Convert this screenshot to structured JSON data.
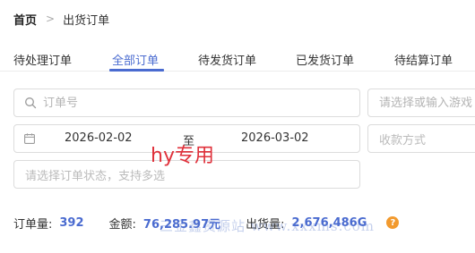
{
  "breadcrumb": {
    "home": "首页",
    "separator": ">",
    "current": "出货订单"
  },
  "tabs": [
    {
      "label": "待处理订单",
      "active": false
    },
    {
      "label": "全部订单",
      "active": true
    },
    {
      "label": "待发货订单",
      "active": false
    },
    {
      "label": "已发货订单",
      "active": false
    },
    {
      "label": "待结算订单",
      "active": false
    }
  ],
  "filters": {
    "order_no_placeholder": "订单号",
    "product_placeholder": "请选择或输入游戏",
    "date_start": "2026-02-02",
    "date_separator": "至",
    "date_end": "2026-03-02",
    "payment_placeholder": "收款方式",
    "status_placeholder": "请选择订单状态，支持多选"
  },
  "stats": {
    "order_count_label": "订单量:",
    "order_count_value": "392",
    "amount_label": "金额:",
    "amount_value": "76,285.97元",
    "shipped_label": "出货量:",
    "shipped_value": "2,676,486G",
    "help_glyph": "?"
  },
  "watermarks": {
    "overlay_text": "hy专用",
    "site_text": "三金鑫资源站 www.xxxms.com"
  },
  "colors": {
    "accent": "#4a6bd0",
    "watermark_red": "#e0313b",
    "help_orange": "#f29a2e"
  },
  "icons": {
    "breadcrumb_separator": "chevron-right-icon",
    "order_search": "search-icon",
    "date": "calendar-icon",
    "help": "help-icon"
  }
}
